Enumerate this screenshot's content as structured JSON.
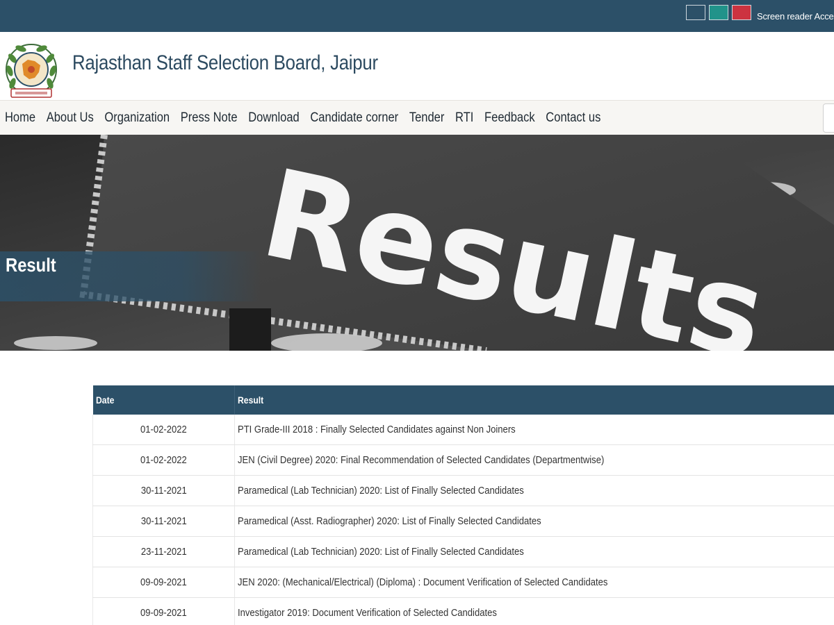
{
  "topbar": {
    "themes": [
      "dark-blue",
      "teal",
      "red"
    ],
    "screen_reader_label": "Screen reader Access",
    "colors": {
      "bar": "#2c5068",
      "teal": "#21938a",
      "red": "#cc3340"
    }
  },
  "header": {
    "logo_icon": "rssb-emblem-icon",
    "title": "Rajasthan Staff Selection Board, Jaipur"
  },
  "nav": {
    "items": [
      "Home",
      "About Us",
      "Organization",
      "Press Note",
      "Download",
      "Candidate corner",
      "Tender",
      "RTI",
      "Feedback",
      "Contact us"
    ]
  },
  "banner": {
    "sign_text": "Results",
    "page_title": "Result"
  },
  "table": {
    "headers": {
      "date": "Date",
      "result": "Result"
    },
    "rows": [
      {
        "date": "01-02-2022",
        "result": "PTI Grade-III 2018 : Finally Selected Candidates against Non Joiners"
      },
      {
        "date": "01-02-2022",
        "result": "JEN (Civil Degree) 2020: Final Recommendation of Selected Candidates (Departmentwise)"
      },
      {
        "date": "30-11-2021",
        "result": "Paramedical (Lab Technician) 2020: List of Finally Selected Candidates"
      },
      {
        "date": "30-11-2021",
        "result": "Paramedical (Asst. Radiographer) 2020: List of Finally Selected Candidates"
      },
      {
        "date": "23-11-2021",
        "result": "Paramedical (Lab Technician) 2020: List of Finally Selected Candidates"
      },
      {
        "date": "09-09-2021",
        "result": "JEN 2020: (Mechanical/Electrical) (Diploma) : Document Verification of Selected Candidates"
      },
      {
        "date": "09-09-2021",
        "result": "Investigator 2019: Document Verification of Selected Candidates"
      }
    ]
  }
}
